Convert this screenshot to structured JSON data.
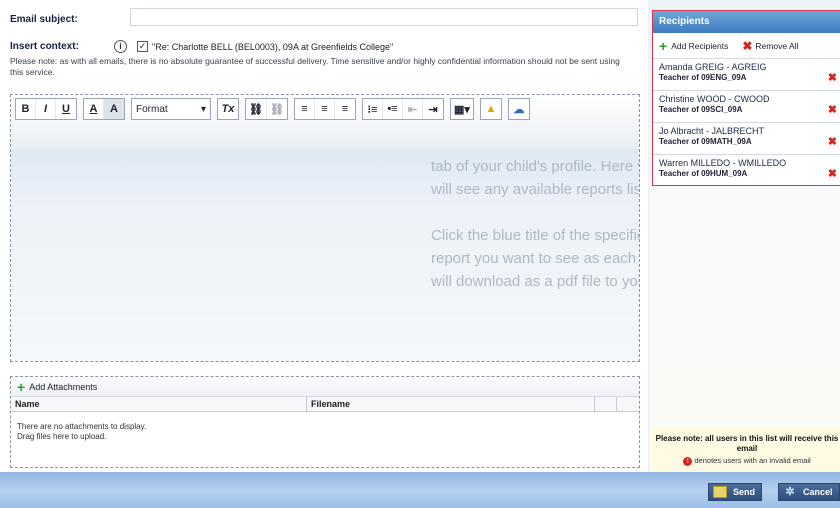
{
  "email": {
    "subject_label": "Email subject:",
    "subject_value": "",
    "context_label": "Insert context:",
    "context_text": "\"Re: Charlotte BELL (BEL0003), 09A at Greenfields College\"",
    "context_checked": true,
    "notice": "Please note: as with all emails, there is no absolute guarantee of successful delivery. Time sensitive and/or highly confidential information should not be sent using this service."
  },
  "toolbar": {
    "bold": "B",
    "italic": "I",
    "underline": "U",
    "text_color": "A",
    "bg_color": "A",
    "format_label": "Format",
    "clear_format": "Tx"
  },
  "editor": {
    "ghost_lines": [
      "tab of your child's profile. Here you",
      "will see any available reports listed.",
      "",
      "Click the blue title of the specific",
      "report you want to see as each is",
      "will download as a pdf file to your"
    ]
  },
  "attachments": {
    "add_label": "Add Attachments",
    "col_name": "Name",
    "col_filename": "Filename",
    "empty_line1": "There are no attachments to display.",
    "empty_line2": "Drag files here to upload."
  },
  "recipients": {
    "title": "Recipients",
    "add_label": "Add Recipients",
    "remove_all_label": "Remove All",
    "items": [
      {
        "name": "Amanda GREIG - AGREIG",
        "role": "Teacher of 09ENG_09A"
      },
      {
        "name": "Christine WOOD - CWOOD",
        "role": "Teacher of 09SCI_09A"
      },
      {
        "name": "Jo Albracht - JALBRECHT",
        "role": "Teacher of 09MATH_09A"
      },
      {
        "name": "Warren MILLEDO - WMILLEDO",
        "role": "Teacher of 09HUM_09A"
      }
    ],
    "note": "Please note: all users in this list will receive this email",
    "legend": "denotes users with an invalid email"
  },
  "footer": {
    "send_label": "Send",
    "cancel_label": "Cancel"
  }
}
